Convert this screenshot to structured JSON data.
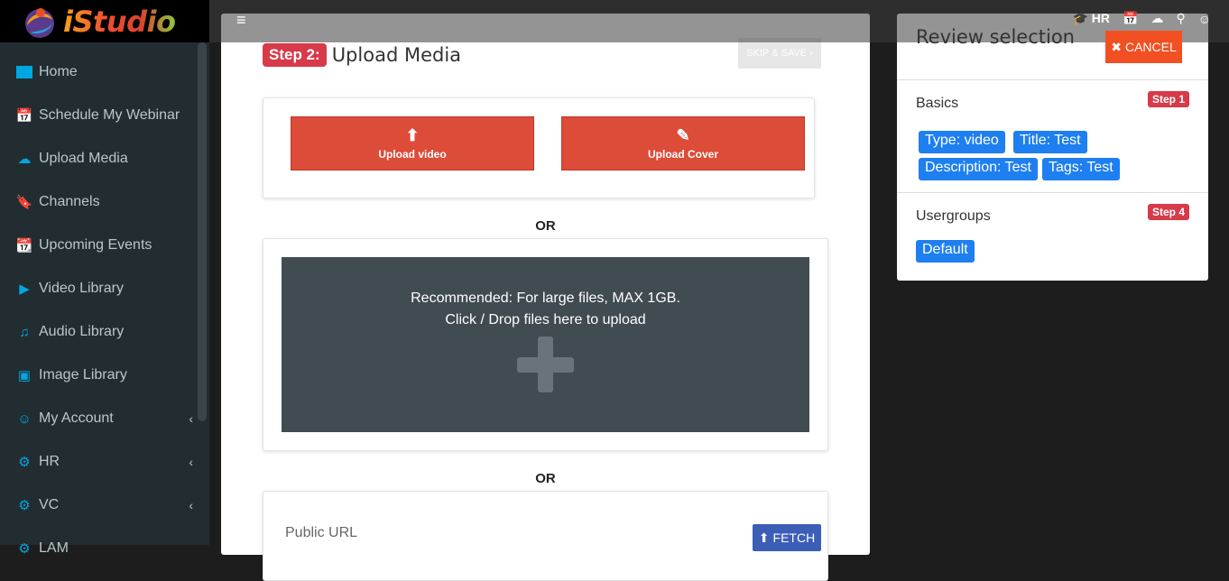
{
  "sidebar": {
    "logo_text": "iStudio",
    "items": [
      {
        "label": "Home",
        "icon": "monitor-icon"
      },
      {
        "label": "Schedule My Webinar",
        "icon": "calendar-plus-icon"
      },
      {
        "label": "Upload Media",
        "icon": "cloud-upload-icon"
      },
      {
        "label": "Channels",
        "icon": "bookmark-icon"
      },
      {
        "label": "Upcoming Events",
        "icon": "calendar-icon"
      },
      {
        "label": "Video Library",
        "icon": "video-icon"
      },
      {
        "label": "Audio Library",
        "icon": "music-icon"
      },
      {
        "label": "Image Library",
        "icon": "image-icon"
      },
      {
        "label": "My Account",
        "icon": "user-icon"
      },
      {
        "label": "HR",
        "icon": "cogs-icon"
      },
      {
        "label": "VC",
        "icon": "cogs-icon"
      },
      {
        "label": "LAM",
        "icon": "cogs-icon"
      }
    ]
  },
  "topbar": {
    "hr_label": "HR"
  },
  "main": {
    "step_badge": "Step 2:",
    "step_title": "Upload Media",
    "skip_label": "SKIP & SAVE",
    "upload_video_label": "Upload video",
    "upload_cover_label": "Upload Cover",
    "or_1": "OR",
    "or_2": "OR",
    "drop_line1": "Recommended: For large files, MAX 1GB.",
    "drop_line2": "Click / Drop files here to upload",
    "public_url_label": "Public URL",
    "fetch_label": "FETCH"
  },
  "review": {
    "title": "Review selection",
    "cancel_label": "CANCEL",
    "basics_title": "Basics",
    "basics_step": "Step 1",
    "basics_tags": [
      "Type: video",
      "Title: Test",
      "Description: Test",
      "Tags: Test"
    ],
    "usergroups_title": "Usergroups",
    "usergroups_step": "Step 4",
    "usergroups_tags": [
      "Default"
    ]
  },
  "colors": {
    "accent_red": "#dd4b39",
    "cancel_orange": "#f25022",
    "tag_blue": "#1e7ff0",
    "sidebar_bg": "#222d32"
  }
}
